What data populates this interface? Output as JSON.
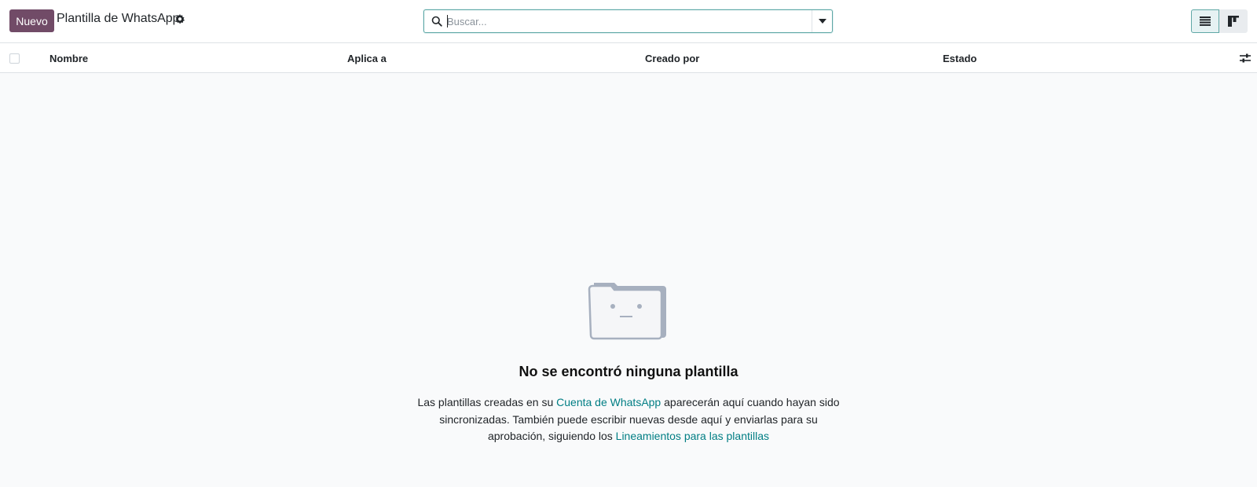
{
  "header": {
    "new_button": "Nuevo",
    "title": "Plantilla de WhatsApp",
    "settings_icon": "gear-icon"
  },
  "search": {
    "placeholder": "Buscar...",
    "icon": "search-icon",
    "toggle_icon": "caret-down-icon"
  },
  "views": [
    {
      "icon": "list-view-icon",
      "active": true
    },
    {
      "icon": "kanban-view-icon",
      "active": false
    }
  ],
  "table": {
    "columns": [
      "Nombre",
      "Aplica a",
      "Creado por",
      "Estado"
    ],
    "optional_columns_icon": "sliders-icon"
  },
  "empty_state": {
    "icon": "sad-folder-icon",
    "title": "No se encontró ninguna plantilla",
    "text_1": "Las plantillas creadas en su ",
    "link_1": "Cuenta de WhatsApp",
    "text_2": " aparecerán aquí cuando hayan sido sincronizadas. También puede escribir nuevas desde aquí y enviarlas para su aprobación, siguiendo los ",
    "link_2": "Lineamientos para las plantillas"
  },
  "colors": {
    "brand": "#714b67",
    "accent": "#017e84",
    "background": "#f9fafb"
  }
}
